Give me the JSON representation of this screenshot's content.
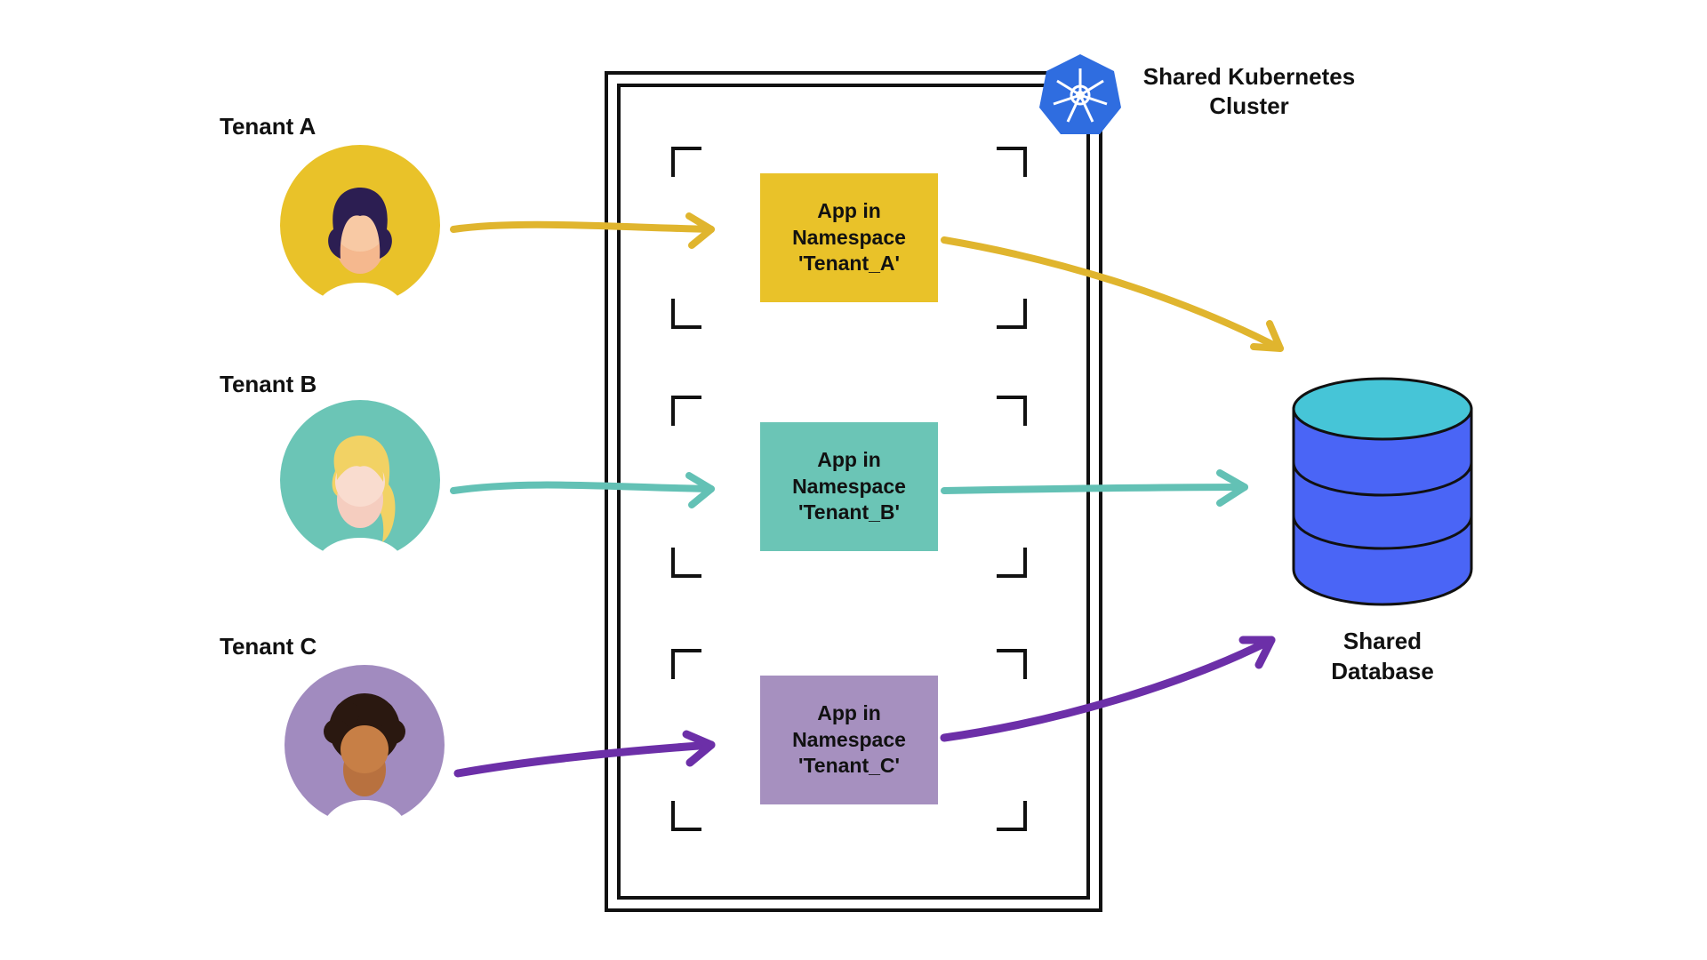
{
  "tenants": [
    {
      "label": "Tenant A"
    },
    {
      "label": "Tenant B"
    },
    {
      "label": "Tenant C"
    }
  ],
  "apps": [
    {
      "text": "App in Namespace 'Tenant_A'"
    },
    {
      "text": "App in Namespace 'Tenant_B'"
    },
    {
      "text": "App in Namespace 'Tenant_C'"
    }
  ],
  "cluster_label": "Shared Kubernetes Cluster",
  "database_label": "Shared Database",
  "colors": {
    "tenantA_bg": "#e9c229",
    "tenantB_bg": "#6bc5b6",
    "tenantC_bg": "#a18bbf",
    "appA": "#e9c229",
    "appB": "#6bc5b6",
    "appC": "#a690bf",
    "arrowA": "#e0b52e",
    "arrowB": "#63c1b5",
    "arrowC": "#6c2fa8",
    "db_body": "#4a65f6",
    "db_top": "#46c5d7",
    "k8s": "#2f6de0"
  }
}
